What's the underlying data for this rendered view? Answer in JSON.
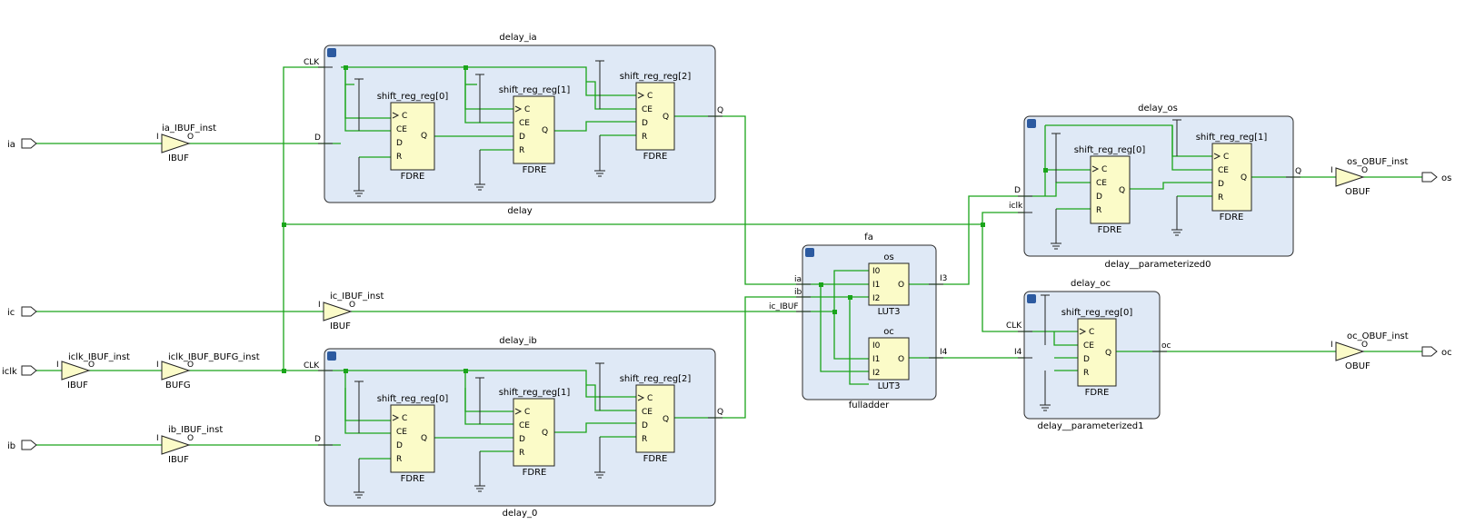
{
  "ports_in": [
    "ia",
    "ic",
    "iclk",
    "ib"
  ],
  "ports_out": [
    "os",
    "oc"
  ],
  "buffers": {
    "ia_ibuf": {
      "name": "ia_IBUF_inst",
      "type": "IBUF"
    },
    "ic_ibuf": {
      "name": "ic_IBUF_inst",
      "type": "IBUF"
    },
    "iclk_ibuf": {
      "name": "iclk_IBUF_inst",
      "type": "IBUF"
    },
    "iclk_bufg": {
      "name": "iclk_IBUF_BUFG_inst",
      "type": "BUFG"
    },
    "ib_ibuf": {
      "name": "ib_IBUF_inst",
      "type": "IBUF"
    },
    "os_obuf": {
      "name": "os_OBUF_inst",
      "type": "OBUF"
    },
    "oc_obuf": {
      "name": "oc_OBUF_inst",
      "type": "OBUF"
    }
  },
  "pin_labels": {
    "i": "I",
    "o": "O",
    "c": "C",
    "ce": "CE",
    "d": "D",
    "r": "R",
    "q": "Q",
    "clk": "CLK",
    "iclk": "iclk",
    "i0": "I0",
    "i1": "I1",
    "i2": "I2",
    "ia": "ia",
    "ib": "ib",
    "ic_ibuf": "ic_IBUF",
    "i3": "I3",
    "i4": "I4",
    "oc": "oc"
  },
  "modules": {
    "delay_ia": {
      "title": "delay_ia",
      "subtitle": "delay",
      "regs": [
        "shift_reg_reg[0]",
        "shift_reg_reg[1]",
        "shift_reg_reg[2]"
      ],
      "cell_type": "FDRE"
    },
    "delay_ib": {
      "title": "delay_ib",
      "subtitle": "delay_0",
      "regs": [
        "shift_reg_reg[0]",
        "shift_reg_reg[1]",
        "shift_reg_reg[2]"
      ],
      "cell_type": "FDRE"
    },
    "delay_os": {
      "title": "delay_os",
      "subtitle": "delay__parameterized0",
      "regs": [
        "shift_reg_reg[0]",
        "shift_reg_reg[1]"
      ],
      "cell_type": "FDRE"
    },
    "delay_oc": {
      "title": "delay_oc",
      "subtitle": "delay__parameterized1",
      "regs": [
        "shift_reg_reg[0]"
      ],
      "cell_type": "FDRE"
    },
    "fa": {
      "title": "fa",
      "subtitle": "fulladder",
      "luts": [
        {
          "name": "os",
          "type": "LUT3"
        },
        {
          "name": "oc",
          "type": "LUT3"
        }
      ]
    }
  },
  "colors": {
    "wire": "#1aa51a",
    "module_fill": "#dfe9f6",
    "cell_fill": "#fbfbc8"
  }
}
